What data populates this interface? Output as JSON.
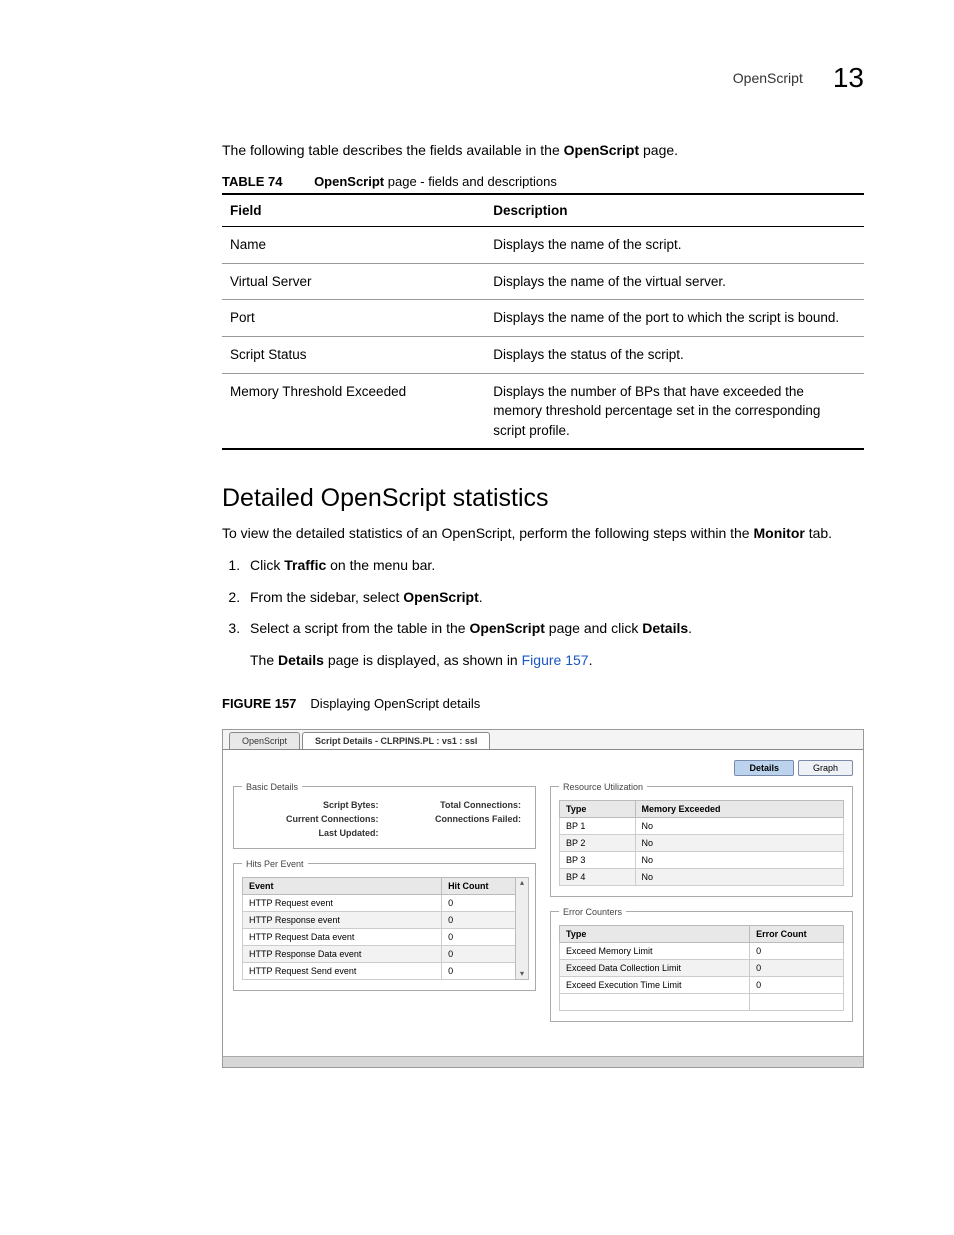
{
  "header": {
    "section": "OpenScript",
    "chapter": "13"
  },
  "intro": {
    "prefix": "The following table describes the fields available in the ",
    "bold": "OpenScript",
    "suffix": " page."
  },
  "table74": {
    "label": "TABLE 74",
    "title_bold": "OpenScript",
    "title_rest": " page - fields and descriptions",
    "head": {
      "field": "Field",
      "desc": "Description"
    },
    "rows": [
      {
        "field": "Name",
        "desc": "Displays the name of the script."
      },
      {
        "field": "Virtual Server",
        "desc": "Displays the name of the virtual server."
      },
      {
        "field": "Port",
        "desc": "Displays the name of the port to which the script is bound."
      },
      {
        "field": "Script Status",
        "desc": "Displays the status of the script."
      },
      {
        "field": "Memory Threshold Exceeded",
        "desc": "Displays the number of BPs that have exceeded the memory threshold percentage set in the corresponding script profile."
      }
    ]
  },
  "section": {
    "heading": "Detailed OpenScript statistics"
  },
  "lead": {
    "prefix": "To view the detailed statistics of an OpenScript, perform the following steps within the ",
    "bold": "Monitor",
    "suffix": " tab."
  },
  "steps": {
    "s1": {
      "a": "Click ",
      "b": "Traffic",
      "c": " on the menu bar."
    },
    "s2": {
      "a": "From the sidebar, select ",
      "b": "OpenScript",
      "c": "."
    },
    "s3": {
      "a": "Select a script from the table in the ",
      "b": "OpenScript",
      "c": " page and click ",
      "d": "Details",
      "e": "."
    },
    "follow": {
      "a": "The ",
      "b": "Details",
      "c": " page is displayed, as shown in ",
      "link": "Figure 157",
      "d": "."
    }
  },
  "figure": {
    "label": "FIGURE 157",
    "title": "Displaying OpenScript details"
  },
  "shot": {
    "tabs": {
      "t1": "OpenScript",
      "t2": "Script Details - CLRPINS.PL : vs1 : ssl"
    },
    "buttons": {
      "details": "Details",
      "graph": "Graph"
    },
    "basic": {
      "legend": "Basic Details",
      "k1": "Script Bytes:",
      "k2": "Total Connections:",
      "k3": "Current Connections:",
      "k4": "Connections Failed:",
      "k5": "Last Updated:"
    },
    "resource": {
      "legend": "Resource Utilization",
      "h1": "Type",
      "h2": "Memory Exceeded",
      "rows": [
        {
          "type": "BP 1",
          "mem": "No"
        },
        {
          "type": "BP 2",
          "mem": "No"
        },
        {
          "type": "BP 3",
          "mem": "No"
        },
        {
          "type": "BP 4",
          "mem": "No"
        }
      ]
    },
    "hits": {
      "legend": "Hits Per Event",
      "h1": "Event",
      "h2": "Hit Count",
      "rows": [
        {
          "ev": "HTTP Request event",
          "hc": "0"
        },
        {
          "ev": "HTTP Response event",
          "hc": "0"
        },
        {
          "ev": "HTTP Request Data event",
          "hc": "0"
        },
        {
          "ev": "HTTP Response Data event",
          "hc": "0"
        },
        {
          "ev": "HTTP Request Send event",
          "hc": "0"
        }
      ]
    },
    "errors": {
      "legend": "Error Counters",
      "h1": "Type",
      "h2": "Error Count",
      "rows": [
        {
          "t": "Exceed Memory Limit",
          "c": "0"
        },
        {
          "t": "Exceed Data Collection Limit",
          "c": "0"
        },
        {
          "t": "Exceed Execution Time Limit",
          "c": "0"
        }
      ]
    }
  }
}
